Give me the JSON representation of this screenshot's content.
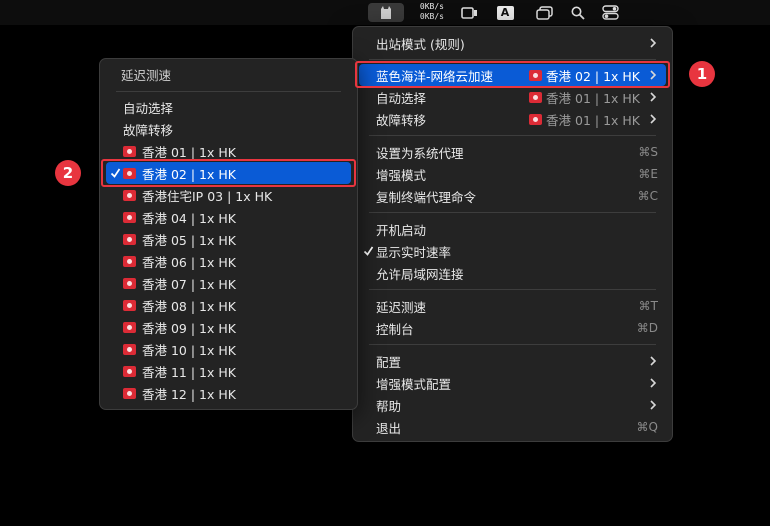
{
  "menubar": {
    "speed_up": "0KB/s",
    "speed_down": "0KB/s",
    "input_source": "A"
  },
  "main_menu": {
    "outbound_mode": {
      "label": "出站模式 (规则)"
    },
    "proxy_group": {
      "label": "蓝色海洋-网络云加速",
      "value": "香港 02 | 1x HK"
    },
    "auto_select": {
      "label": "自动选择",
      "value": "香港 01 | 1x HK"
    },
    "failover": {
      "label": "故障转移",
      "value": "香港 01 | 1x HK"
    },
    "set_system_proxy": {
      "label": "设置为系统代理",
      "shortcut": "⌘S"
    },
    "enhanced_mode": {
      "label": "增强模式",
      "shortcut": "⌘E"
    },
    "copy_terminal": {
      "label": "复制终端代理命令",
      "shortcut": "⌘C"
    },
    "launch_at_login": {
      "label": "开机启动"
    },
    "show_speed": {
      "label": "显示实时速率",
      "checked": true
    },
    "allow_lan": {
      "label": "允许局域网连接"
    },
    "latency_test": {
      "label": "延迟测速",
      "shortcut": "⌘T"
    },
    "dashboard": {
      "label": "控制台",
      "shortcut": "⌘D"
    },
    "config": {
      "label": "配置"
    },
    "enhanced_config": {
      "label": "增强模式配置"
    },
    "help": {
      "label": "帮助"
    },
    "quit": {
      "label": "退出",
      "shortcut": "⌘Q"
    }
  },
  "sub_menu": {
    "latency_test": "延迟测速",
    "auto_select": "自动选择",
    "failover": "故障转移",
    "nodes": [
      {
        "label": "香港 01 | 1x HK",
        "checked": false
      },
      {
        "label": "香港 02 | 1x HK",
        "checked": true
      },
      {
        "label": "香港住宅IP 03 | 1x HK",
        "checked": false
      },
      {
        "label": "香港 04 | 1x HK",
        "checked": false
      },
      {
        "label": "香港 05 | 1x HK",
        "checked": false
      },
      {
        "label": "香港 06 | 1x HK",
        "checked": false
      },
      {
        "label": "香港 07 | 1x HK",
        "checked": false
      },
      {
        "label": "香港 08 | 1x HK",
        "checked": false
      },
      {
        "label": "香港 09 | 1x HK",
        "checked": false
      },
      {
        "label": "香港 10 | 1x HK",
        "checked": false
      },
      {
        "label": "香港 11 | 1x HK",
        "checked": false
      },
      {
        "label": "香港 12 | 1x HK",
        "checked": false
      }
    ]
  },
  "annotations": {
    "badge1": "1",
    "badge2": "2"
  },
  "colors": {
    "highlight": "#0a5bd6",
    "annotation": "#e8353f",
    "menu_bg": "#232323"
  }
}
